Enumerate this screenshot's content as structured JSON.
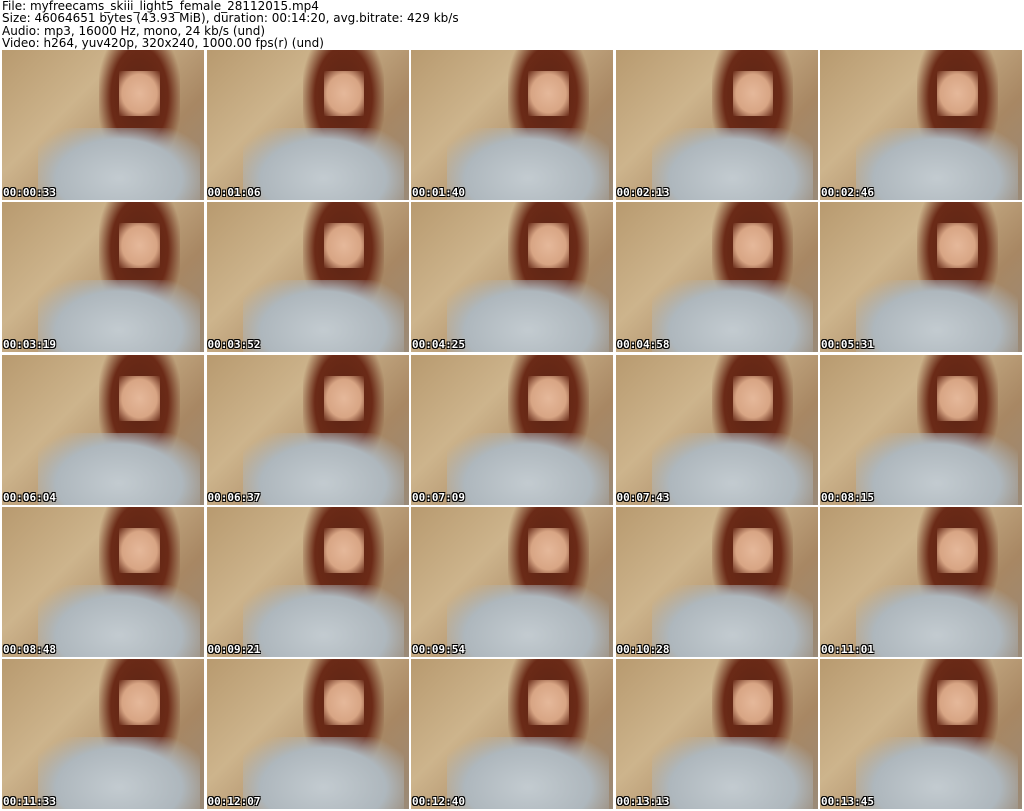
{
  "header": {
    "file_line": "File: myfreecams_skiii_light5_female_28112015.mp4",
    "size_line": "Size: 46064651 bytes (43.93 MiB), duration: 00:14:20, avg.bitrate: 429 kb/s",
    "audio_line": "Audio: mp3, 16000 Hz, mono, 24 kb/s (und)",
    "video_line": "Video: h264, yuv420p, 320x240, 1000.00 fps(r) (und)"
  },
  "thumbnails": [
    {
      "timestamp": "00:00:33"
    },
    {
      "timestamp": "00:01:06"
    },
    {
      "timestamp": "00:01:40"
    },
    {
      "timestamp": "00:02:13"
    },
    {
      "timestamp": "00:02:46"
    },
    {
      "timestamp": "00:03:19"
    },
    {
      "timestamp": "00:03:52"
    },
    {
      "timestamp": "00:04:25"
    },
    {
      "timestamp": "00:04:58"
    },
    {
      "timestamp": "00:05:31"
    },
    {
      "timestamp": "00:06:04"
    },
    {
      "timestamp": "00:06:37"
    },
    {
      "timestamp": "00:07:09"
    },
    {
      "timestamp": "00:07:43"
    },
    {
      "timestamp": "00:08:15"
    },
    {
      "timestamp": "00:08:48"
    },
    {
      "timestamp": "00:09:21"
    },
    {
      "timestamp": "00:09:54"
    },
    {
      "timestamp": "00:10:28"
    },
    {
      "timestamp": "00:11:01"
    },
    {
      "timestamp": "00:11:33"
    },
    {
      "timestamp": "00:12:07"
    },
    {
      "timestamp": "00:12:40"
    },
    {
      "timestamp": "00:13:13"
    },
    {
      "timestamp": "00:13:45"
    }
  ]
}
